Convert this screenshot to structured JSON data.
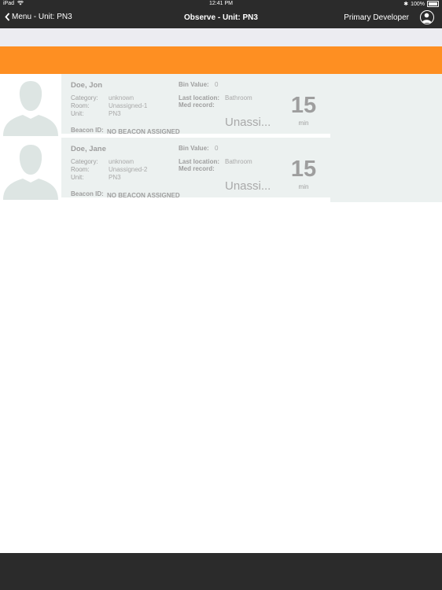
{
  "status_bar": {
    "device": "iPad",
    "wifi_icon": "wifi-icon",
    "time": "12:41 PM",
    "bluetooth_icon": "bluetooth-icon",
    "battery": "100%"
  },
  "nav": {
    "back_label": "Menu - Unit: PN3",
    "title": "Observe - Unit: PN3",
    "user_name": "Primary Developer",
    "avatar_icon": "user-circle-icon"
  },
  "colors": {
    "nav_bg": "#2b2b2b",
    "accent": "#fe8f22",
    "card_bg": "#ecf1f0",
    "filter_bg": "#ececf1"
  },
  "patients": [
    {
      "name": "Doe, Jon",
      "category_label": "Category:",
      "category": "unknown",
      "room_label": "Room:",
      "room": "Unassigned-1",
      "unit_label": "Unit:",
      "unit": "PN3",
      "bin_label": "Bin Value:",
      "bin_value": "0",
      "last_location_label": "Last location:",
      "last_location": "Bathroom",
      "med_record_label": "Med record:",
      "med_record": "Unassi...",
      "minutes": "15",
      "minutes_unit": "min",
      "beacon_label": "Beacon ID:",
      "beacon_value": "NO BEACON ASSIGNED"
    },
    {
      "name": "Doe, Jane",
      "category_label": "Category:",
      "category": "unknown",
      "room_label": "Room:",
      "room": "Unassigned-2",
      "unit_label": "Unit:",
      "unit": "PN3",
      "bin_label": "Bin Value:",
      "bin_value": "0",
      "last_location_label": "Last location:",
      "last_location": "Bathroom",
      "med_record_label": "Med record:",
      "med_record": "Unassi...",
      "minutes": "15",
      "minutes_unit": "min",
      "beacon_label": "Beacon ID:",
      "beacon_value": "NO BEACON ASSIGNED"
    }
  ]
}
